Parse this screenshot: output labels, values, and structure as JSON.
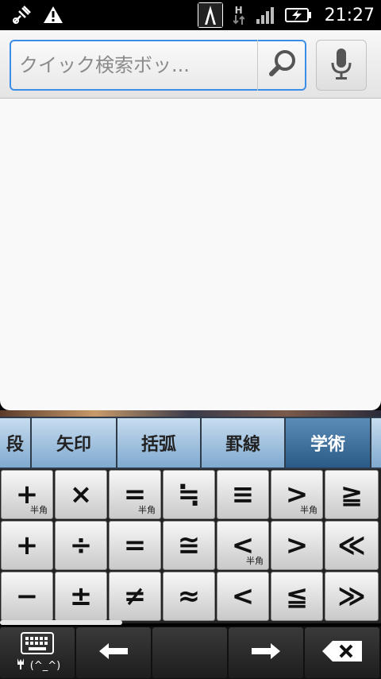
{
  "status_bar": {
    "time": "21:27",
    "network_label": "H",
    "icons": [
      "usb-debug-icon",
      "warning-icon",
      "app-notification-icon",
      "data-transfer-icon",
      "signal-icon",
      "battery-charging-icon"
    ]
  },
  "search": {
    "placeholder": "クイック検索ボッ...",
    "search_icon": "search-icon",
    "voice_icon": "microphone-icon"
  },
  "keyboard": {
    "tabs": [
      {
        "label": "段",
        "active": false
      },
      {
        "label": "矢印",
        "active": false
      },
      {
        "label": "括弧",
        "active": false
      },
      {
        "label": "罫線",
        "active": false
      },
      {
        "label": "学術",
        "active": true
      }
    ],
    "rows": [
      [
        {
          "sym": "+",
          "sub": "半角"
        },
        {
          "sym": "×",
          "sub": ""
        },
        {
          "sym": "=",
          "sub": "半角"
        },
        {
          "sym": "≒",
          "sub": ""
        },
        {
          "sym": "≡",
          "sub": ""
        },
        {
          "sym": ">",
          "sub": "半角"
        },
        {
          "sym": "≧",
          "sub": ""
        }
      ],
      [
        {
          "sym": "+",
          "sub": ""
        },
        {
          "sym": "÷",
          "sub": ""
        },
        {
          "sym": "=",
          "sub": ""
        },
        {
          "sym": "≅",
          "sub": ""
        },
        {
          "sym": "<",
          "sub": "半角"
        },
        {
          "sym": ">",
          "sub": ""
        },
        {
          "sym": "≪",
          "sub": ""
        }
      ],
      [
        {
          "sym": "−",
          "sub": ""
        },
        {
          "sym": "±",
          "sub": ""
        },
        {
          "sym": "≠",
          "sub": ""
        },
        {
          "sym": "≈",
          "sub": ""
        },
        {
          "sym": "<",
          "sub": ""
        },
        {
          "sym": "≦",
          "sub": ""
        },
        {
          "sym": "≫",
          "sub": ""
        }
      ]
    ],
    "bottom": {
      "emoticon_label": "(^_^)",
      "keyboard_icon": "keyboard-icon",
      "left_arrow_icon": "left-arrow-icon",
      "right_arrow_icon": "right-arrow-icon",
      "backspace_icon": "backspace-icon"
    }
  }
}
